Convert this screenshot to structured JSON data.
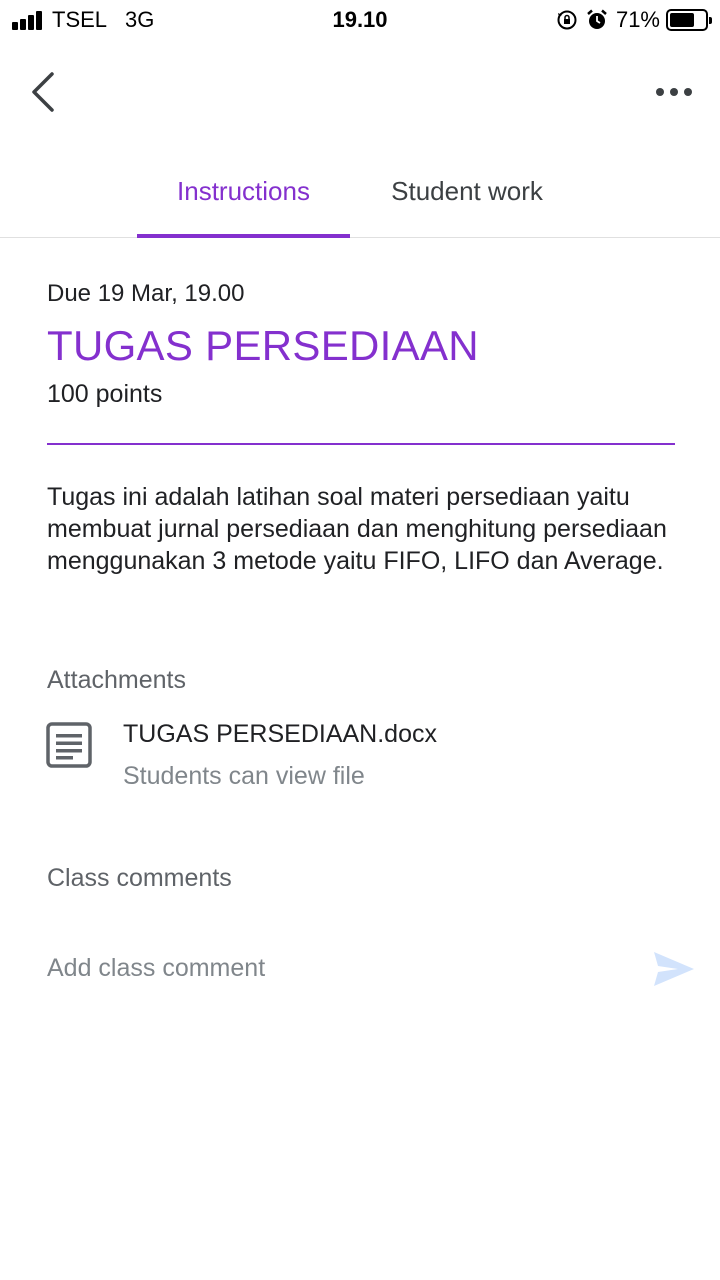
{
  "status_bar": {
    "carrier": "TSEL",
    "network": "3G",
    "time": "19.10",
    "battery": "71%",
    "battery_level": 0.71,
    "icons": [
      "signal-icon",
      "rotation-lock-icon",
      "alarm-icon",
      "battery-icon"
    ]
  },
  "toolbar": {
    "back_icon": "chevron-left-icon",
    "more_icon": "more-horizontal-icon"
  },
  "tabs": [
    {
      "label": "Instructions",
      "active": true
    },
    {
      "label": "Student work",
      "active": false
    }
  ],
  "assignment": {
    "due": "Due 19 Mar, 19.00",
    "title": "TUGAS PERSEDIAAN",
    "points": "100 points",
    "description": "Tugas ini adalah latihan soal materi persediaan yaitu membuat jurnal persediaan dan menghitung persediaan menggunakan 3 metode yaitu FIFO, LIFO dan Average."
  },
  "attachments": {
    "label": "Attachments",
    "items": [
      {
        "icon": "document-icon",
        "name": "TUGAS PERSEDIAAN.docx",
        "subtitle": "Students can view file"
      }
    ]
  },
  "comments": {
    "label": "Class comments",
    "placeholder": "Add class comment",
    "send_icon": "send-icon"
  },
  "colors": {
    "accent": "#8430ce",
    "send_disabled": "#d2e3fc"
  }
}
